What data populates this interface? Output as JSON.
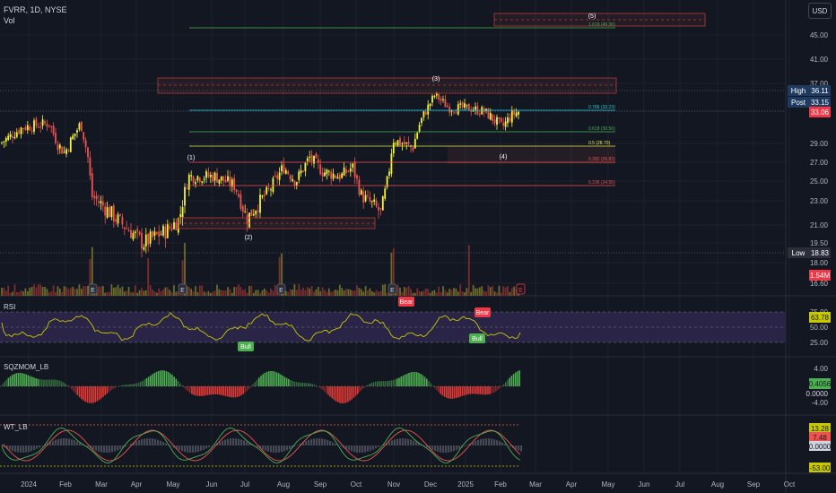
{
  "header": {
    "symbol": "FVRR, 1D, NYSE",
    "volume_label": "Vol",
    "currency": "USD"
  },
  "colors": {
    "background": "#131722",
    "up": "#f5f538",
    "down": "#ef5350",
    "grid": "#1e222d",
    "axis_text": "#b2b5be",
    "green_level": "#4caf50",
    "fib_line": "#26c6da",
    "rsi_line": "#c8c800",
    "rsi_band": "#2a2447",
    "sqz_up": "#4caf50",
    "sqz_down": "#e53935",
    "wt1": "#4caf50",
    "wt2": "#ef5350",
    "wt_hist": "#787b86"
  },
  "price_axis": {
    "ticks": [
      "45.00",
      "41.00",
      "37.00",
      "33.00",
      "29.00",
      "27.00",
      "25.00",
      "23.00",
      "21.00",
      "19.50",
      "18.00",
      "16.60"
    ],
    "labels": [
      {
        "label": "High",
        "value": "36.11",
        "color": "#1e3a5f"
      },
      {
        "label": "Post",
        "value": "33.15",
        "color": "#1e3a5f"
      },
      {
        "label": "",
        "value": "33.06",
        "color": "#f23645"
      },
      {
        "label": "Low",
        "value": "18.83",
        "color": "#2a2e39"
      },
      {
        "label": "",
        "value": "1.54M",
        "color": "#f23645"
      }
    ]
  },
  "time_axis": [
    "2024",
    "Feb",
    "Mar",
    "Apr",
    "May",
    "Jun",
    "Jul",
    "Aug",
    "Sep",
    "Oct",
    "Nov",
    "Dec",
    "2025",
    "Feb",
    "Mar",
    "Apr",
    "May",
    "Jun",
    "Jul",
    "Aug",
    "Sep",
    "Oct"
  ],
  "wave_labels": [
    "(1)",
    "(2)",
    "(3)",
    "(4)",
    "(5)"
  ],
  "fib_levels": [
    {
      "text": "1.618 (45.36)"
    },
    {
      "text": "0.786 (33.23)"
    },
    {
      "text": "0.618 (30.56)"
    },
    {
      "text": "0.5 (28.70)"
    },
    {
      "text": "0.382 (26.83)"
    },
    {
      "text": "0.236 (24.55)"
    }
  ],
  "earnings_marker": "E",
  "rsi": {
    "title": "RSI",
    "ticks": [
      "75.00",
      "50.00",
      "25.00"
    ],
    "value": "63.78",
    "signals": [
      "Bull",
      "Bear",
      "Bear",
      "Bull"
    ]
  },
  "sqzmom": {
    "title": "SQZMOM_LB",
    "ticks": [
      "4.00",
      "-4.00"
    ],
    "values": [
      "0.4056",
      "0.0000"
    ]
  },
  "wt": {
    "title": "WT_LB",
    "ticks": [
      "-53.00"
    ],
    "values": [
      "13.28",
      "7.48",
      "0.0000"
    ]
  },
  "chart_data": {
    "type": "candlestick",
    "symbol": "FVRR",
    "interval": "1D",
    "exchange": "NYSE",
    "segments": [
      {
        "period": "Jan 2024",
        "close_range": [
          27.5,
          31.5
        ]
      },
      {
        "period": "Feb 2024",
        "close_range": [
          27.0,
          31.8
        ]
      },
      {
        "period": "Mar 2024",
        "close_range": [
          21.0,
          24.5
        ]
      },
      {
        "period": "Apr 2024",
        "close_range": [
          19.3,
          22.0
        ]
      },
      {
        "period": "May 2024",
        "close_range": [
          24.0,
          26.5
        ]
      },
      {
        "period": "Jun 2024",
        "close_range": [
          23.0,
          25.5
        ]
      },
      {
        "period": "Jul 2024",
        "close_range": [
          21.5,
          24.5
        ]
      },
      {
        "period": "Aug 2024",
        "close_range": [
          22.0,
          27.0
        ]
      },
      {
        "period": "Sep 2024",
        "close_range": [
          24.5,
          26.5
        ]
      },
      {
        "period": "Oct 2024",
        "close_range": [
          22.0,
          25.0
        ]
      },
      {
        "period": "Nov 2024",
        "close_range": [
          26.5,
          31.5
        ]
      },
      {
        "period": "Dec 2024",
        "close_range": [
          33.0,
          36.1
        ]
      },
      {
        "period": "Jan 2025",
        "close_range": [
          31.5,
          34.5
        ]
      },
      {
        "period": "Feb 2025",
        "close_range": [
          31.0,
          33.15
        ]
      }
    ],
    "high": 36.11,
    "low": 18.83,
    "last_close": 33.06,
    "post_market": 33.15,
    "volume_last": "1.54M"
  }
}
